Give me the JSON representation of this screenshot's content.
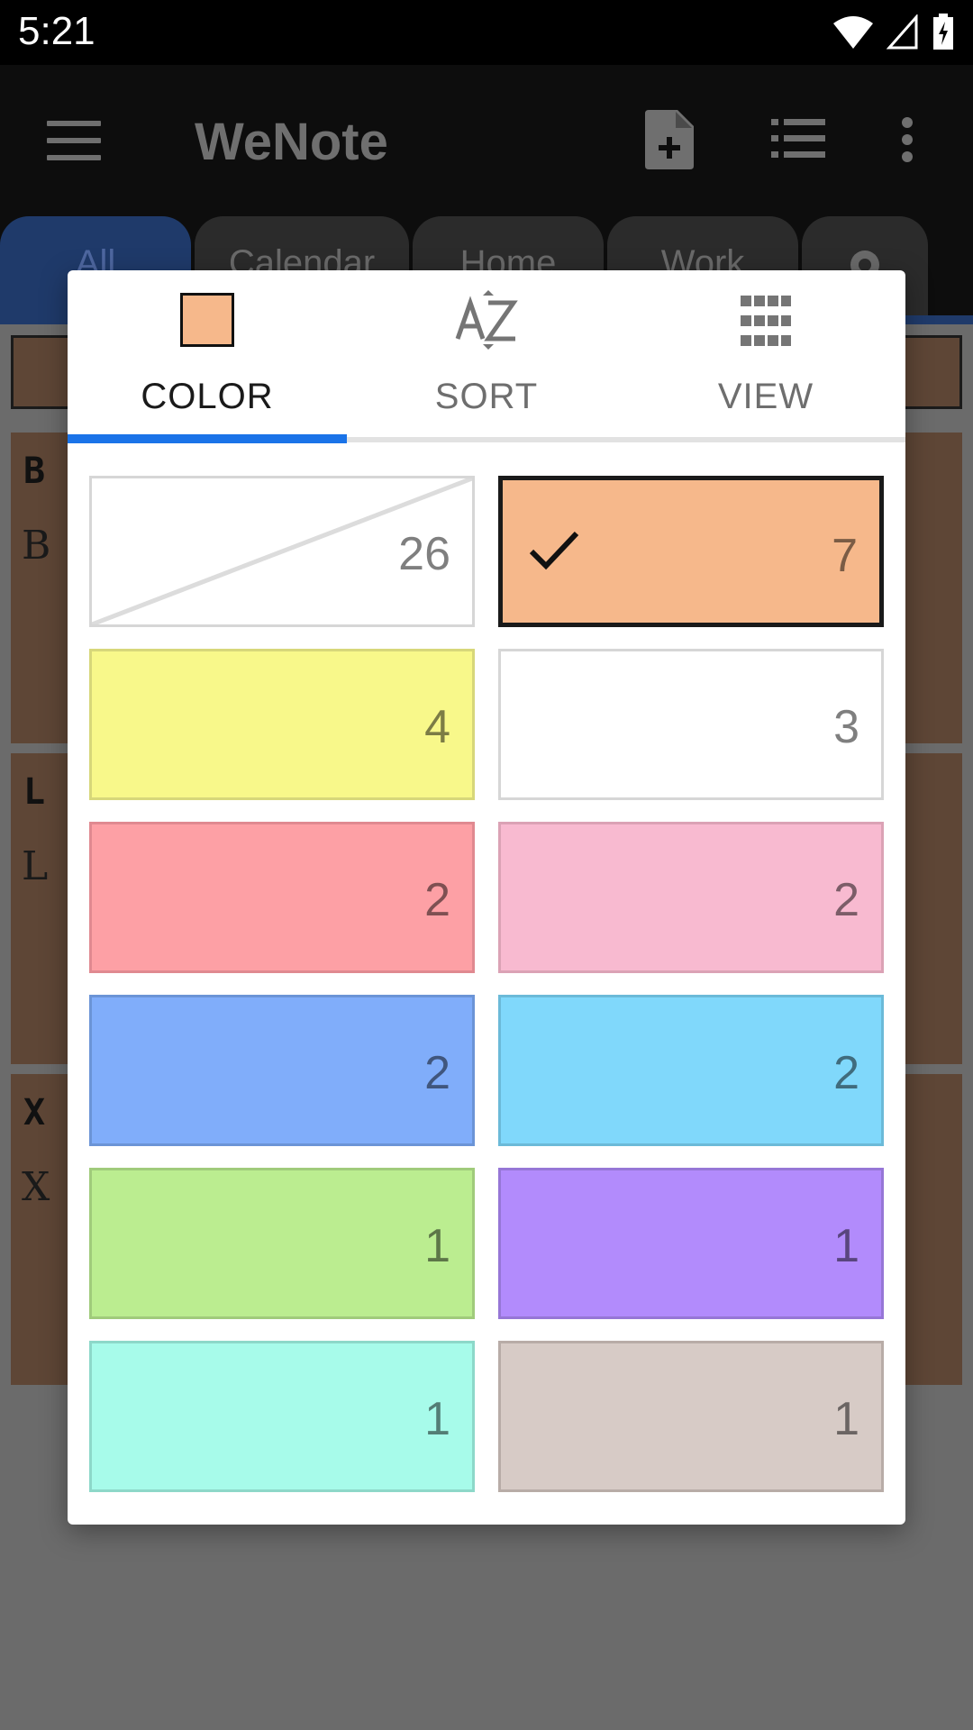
{
  "status_bar": {
    "time": "5:21",
    "icons": [
      "wifi-icon",
      "signal-icon",
      "battery-charging-icon"
    ]
  },
  "app_bar": {
    "title": "WeNote",
    "icons": [
      "menu-icon",
      "add-note-icon",
      "list-view-icon",
      "more-vert-icon"
    ]
  },
  "tabs": [
    {
      "label": "All",
      "active": true
    },
    {
      "label": "Calendar"
    },
    {
      "label": "Home"
    },
    {
      "label": "Work"
    },
    {
      "label": "",
      "icon": "gear-icon"
    }
  ],
  "background_cards": [
    {
      "title": "B",
      "body": "B"
    },
    {
      "title": "L",
      "body": "L"
    },
    {
      "title": "X",
      "body": "X"
    }
  ],
  "dialog": {
    "tabs": [
      {
        "label": "COLOR",
        "icon": "color-swatch-icon",
        "active": true
      },
      {
        "label": "SORT",
        "icon": "sort-az-icon"
      },
      {
        "label": "VIEW",
        "icon": "grid-view-icon"
      }
    ],
    "swatches": [
      {
        "name": "no-color",
        "count": "26",
        "color": "#ffffff",
        "border": "#d6d6d6",
        "diagonal": true
      },
      {
        "name": "orange",
        "count": "7",
        "color": "#f6b88b",
        "border": "#1a1a1a",
        "selected": true
      },
      {
        "name": "yellow",
        "count": "4",
        "color": "#f8f88a",
        "border": "#d7d77a"
      },
      {
        "name": "white",
        "count": "3",
        "color": "#ffffff",
        "border": "#d6d6d6"
      },
      {
        "name": "red",
        "count": "2",
        "color": "#fda0a5",
        "border": "#e08990"
      },
      {
        "name": "pink",
        "count": "2",
        "color": "#f8bad0",
        "border": "#dba2b5"
      },
      {
        "name": "blue",
        "count": "2",
        "color": "#80adfa",
        "border": "#6b94d6"
      },
      {
        "name": "cyan",
        "count": "2",
        "color": "#80d8fb",
        "border": "#6bbad8"
      },
      {
        "name": "green",
        "count": "1",
        "color": "#bbed90",
        "border": "#a0cb7b"
      },
      {
        "name": "purple",
        "count": "1",
        "color": "#b28bfc",
        "border": "#9676d6"
      },
      {
        "name": "aqua",
        "count": "1",
        "color": "#a7fbea",
        "border": "#8dd8c9"
      },
      {
        "name": "taupe",
        "count": "1",
        "color": "#d7cbc6",
        "border": "#b8aca7"
      }
    ]
  }
}
